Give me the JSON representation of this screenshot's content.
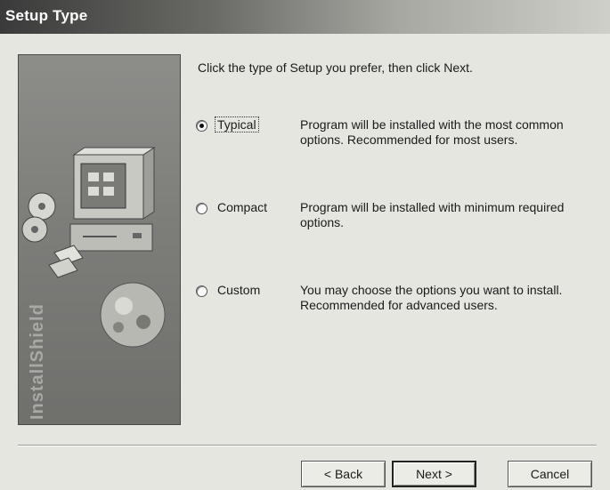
{
  "window": {
    "title": "Setup Type"
  },
  "side_panel": {
    "brand": "InstallShield"
  },
  "main": {
    "instruction": "Click the type of Setup you prefer, then click Next.",
    "options": [
      {
        "label": "Typical",
        "description": "Program will be installed with the most common options. Recommended for most users.",
        "selected": true
      },
      {
        "label": "Compact",
        "description": "Program will be installed with minimum required options.",
        "selected": false
      },
      {
        "label": "Custom",
        "description": "You may choose the options you want to install. Recommended for advanced users.",
        "selected": false
      }
    ]
  },
  "buttons": {
    "back": "< Back",
    "next": "Next >",
    "cancel": "Cancel"
  },
  "colors": {
    "titlebar_start": "#3a3a3a",
    "titlebar_end": "#cfcfca",
    "dialog_bg": "#e6e6e1",
    "side_panel_bg": "#7d7d7a"
  }
}
